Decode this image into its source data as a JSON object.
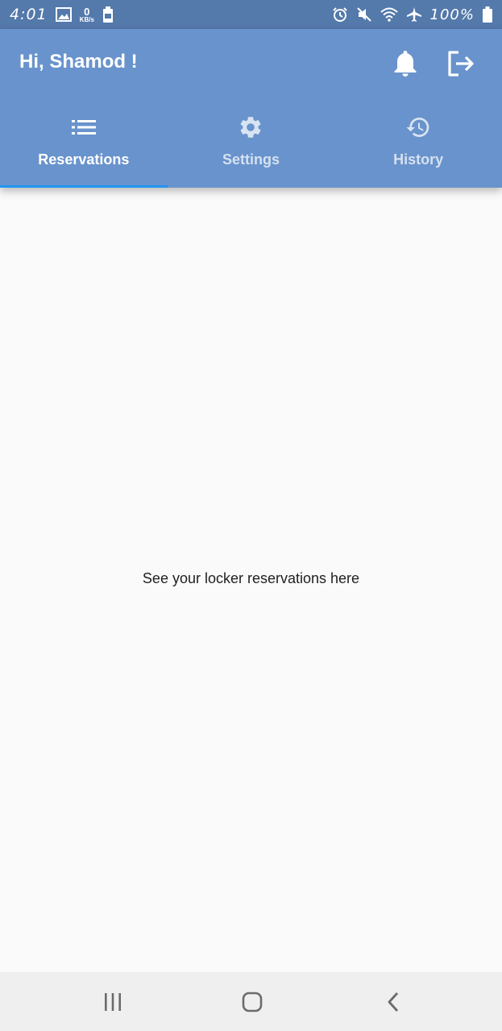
{
  "status_bar": {
    "time": "4:01",
    "network_speed_value": "0",
    "network_speed_unit": "KB/s",
    "battery_percent": "100%",
    "icons": [
      "image-icon",
      "battery-saver-icon",
      "alarm-icon",
      "mute-icon",
      "wifi-icon",
      "airplane-mode-icon",
      "battery-icon"
    ]
  },
  "header": {
    "greeting": "Hi, Shamod !",
    "actions": [
      "notifications-icon",
      "logout-icon"
    ]
  },
  "tabs": [
    {
      "label": "Reservations",
      "icon": "list-icon",
      "selected": true
    },
    {
      "label": "Settings",
      "icon": "gear-icon",
      "selected": false
    },
    {
      "label": "History",
      "icon": "history-icon",
      "selected": false
    }
  ],
  "main": {
    "empty_message": "See your locker reservations here"
  },
  "nav_bar": {
    "buttons": [
      "recent-apps-icon",
      "home-icon",
      "back-icon"
    ]
  },
  "colors": {
    "status_bar": "#5479ab",
    "app_bar": "#6993cc",
    "tab_indicator": "#2196f3",
    "background": "#fafafa",
    "nav_bar": "#efefef"
  }
}
